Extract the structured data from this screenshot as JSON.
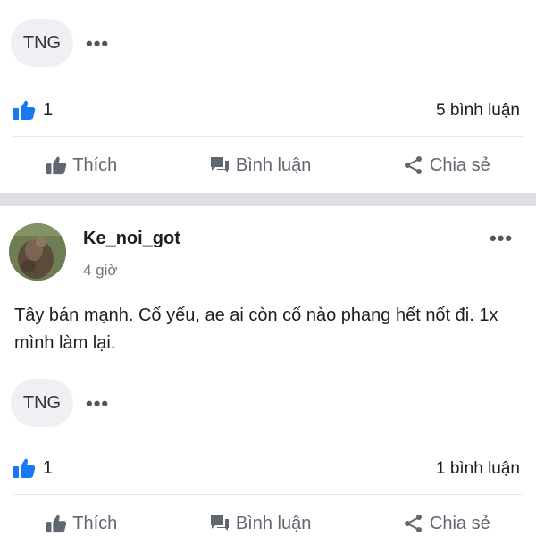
{
  "posts": [
    {
      "tag": "TNG",
      "more": "•••",
      "likes": "1",
      "comments": "5 bình luận",
      "actions": {
        "like": "Thích",
        "comment": "Bình luận",
        "share": "Chia sẻ"
      }
    },
    {
      "author": "Ke_noi_got",
      "time": "4 giờ",
      "more_header": "•••",
      "text": "Tây bán mạnh. Cổ yếu, ae ai còn cổ nào phang hết nốt đi. 1x mình làm lại.",
      "tag": "TNG",
      "more": "•••",
      "likes": "1",
      "comments": "1 bình luận",
      "actions": {
        "like": "Thích",
        "comment": "Bình luận",
        "share": "Chia sẻ"
      }
    }
  ],
  "colors": {
    "like_blue": "#1877f2",
    "action_gray": "#606770",
    "separator": "#dddfe2"
  },
  "icons": {
    "like": "thumbs-up-icon",
    "comment": "comment-icon",
    "share": "share-icon"
  }
}
